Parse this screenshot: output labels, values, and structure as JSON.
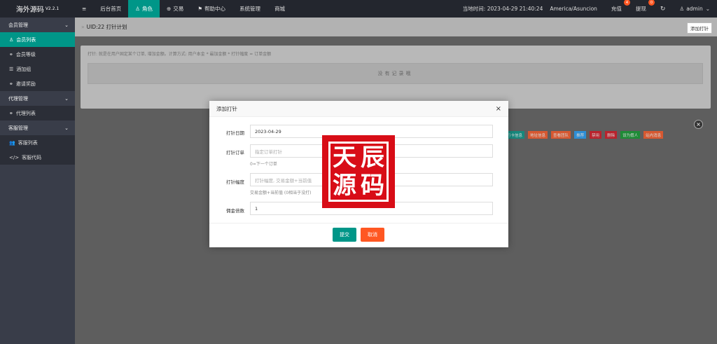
{
  "app": {
    "name": "海外源码",
    "version": "V2.2.1"
  },
  "topnav": {
    "menu_icon": "≡",
    "items": [
      {
        "label": "后台首页"
      },
      {
        "label": "角色",
        "icon": "user-icon",
        "active": true
      },
      {
        "label": "交易",
        "icon": "globe-icon"
      },
      {
        "label": "帮助中心",
        "icon": "flag-icon"
      },
      {
        "label": "系统管理"
      },
      {
        "label": "商城"
      }
    ],
    "time_text": "当地时间: 2023-04-29 21:40:24",
    "timezone": "America/Asuncion",
    "recharge": {
      "label": "充值",
      "count": "4"
    },
    "withdraw": {
      "label": "提现",
      "count": "0"
    },
    "user": "admin"
  },
  "sidebar": {
    "groups": [
      {
        "label": "会员管理",
        "items": [
          {
            "label": "会员列表",
            "icon": "user-icon",
            "active": true
          },
          {
            "label": "会员等级",
            "icon": "link-icon"
          },
          {
            "label": "酒加组",
            "icon": "list-icon"
          },
          {
            "label": "邀请奖励",
            "icon": "link-icon"
          }
        ]
      },
      {
        "label": "代理管理",
        "items": [
          {
            "label": "代理列表",
            "icon": "link-icon"
          }
        ]
      },
      {
        "label": "客服管理",
        "items": [
          {
            "label": "客服列表",
            "icon": "users-icon"
          },
          {
            "label": "客服代码",
            "icon": "code-icon"
          }
        ]
      }
    ]
  },
  "page": {
    "breadcrumb": "UID:22 打针计划",
    "add_button": "添加打针",
    "description": "打针: 就是在用户固定某个订单, 增加金额。计算方式: 用户本金 * 最加金额 * 打针幅度 = 订单金额",
    "empty_text": "没有记录哦"
  },
  "action_buttons": [
    {
      "label": "银",
      "color": "#009688"
    },
    {
      "label": "银行卡信息",
      "color": "#009688"
    },
    {
      "label": "地址信息",
      "color": "#ff5722"
    },
    {
      "label": "查看团队",
      "color": "#ff5722"
    },
    {
      "label": "推荐",
      "color": "#1e9fff"
    },
    {
      "label": "禁用",
      "color": "#d8101d"
    },
    {
      "label": "删除",
      "color": "#d8101d"
    },
    {
      "label": "设为假人",
      "color": "#0a9b2a"
    },
    {
      "label": "站内消息",
      "color": "#ff5722"
    }
  ],
  "modal": {
    "title": "添加打针",
    "fields": [
      {
        "label": "打针日期",
        "value": "2023-04-29",
        "placeholder": ""
      },
      {
        "label": "打针订单",
        "value": "",
        "placeholder": "指定订单打针",
        "hint": "0=下一个订单"
      },
      {
        "label": "打针幅度",
        "value": "",
        "placeholder": "打针幅度, 交易金额+当前值",
        "hint": "交易金额+当前值 (0相当于没打)"
      },
      {
        "label": "佣金倍数",
        "value": "1",
        "placeholder": ""
      }
    ],
    "submit": "提交",
    "cancel": "取消"
  },
  "watermark": {
    "chars": [
      "天",
      "辰",
      "源",
      "码"
    ],
    "color": "#d80d17"
  }
}
